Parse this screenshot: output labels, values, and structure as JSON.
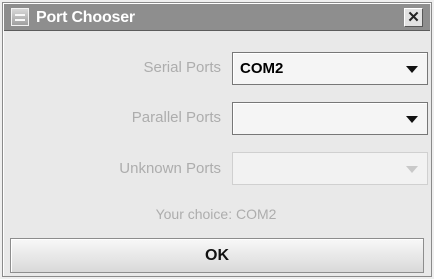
{
  "window": {
    "title": "Port Chooser",
    "close_label": "✕"
  },
  "ports": [
    {
      "label": "Serial Ports",
      "value": "COM2",
      "enabled": true
    },
    {
      "label": "Parallel Ports",
      "value": "",
      "enabled": true
    },
    {
      "label": "Unknown Ports",
      "value": "",
      "enabled": false
    }
  ],
  "choice": {
    "text": "Your choice: COM2"
  },
  "actions": {
    "ok_label": "OK"
  },
  "icons": {
    "window": "window-icon",
    "close": "close-icon",
    "dropdown": "chevron-down-icon"
  },
  "colors": {
    "title_bar": "#8e8e8e",
    "window_background": "#e9e9e9",
    "disabled_text": "#adadad"
  }
}
